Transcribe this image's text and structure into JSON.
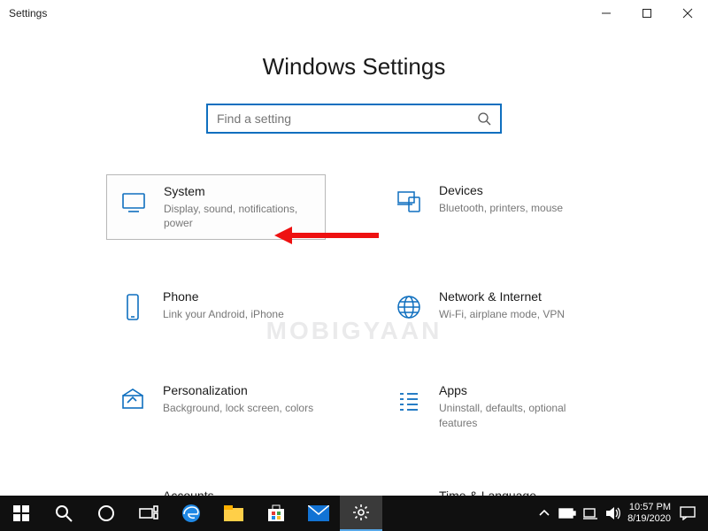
{
  "titlebar": {
    "app": "Settings"
  },
  "header": {
    "title": "Windows Settings"
  },
  "search": {
    "placeholder": "Find a setting",
    "value": ""
  },
  "watermark": "MOBIGYAAN",
  "tiles": [
    {
      "title": "System",
      "desc": "Display, sound, notifications, power"
    },
    {
      "title": "Devices",
      "desc": "Bluetooth, printers, mouse"
    },
    {
      "title": "Phone",
      "desc": "Link your Android, iPhone"
    },
    {
      "title": "Network & Internet",
      "desc": "Wi-Fi, airplane mode, VPN"
    },
    {
      "title": "Personalization",
      "desc": "Background, lock screen, colors"
    },
    {
      "title": "Apps",
      "desc": "Uninstall, defaults, optional features"
    },
    {
      "title": "Accounts",
      "desc": ""
    },
    {
      "title": "Time & Language",
      "desc": ""
    }
  ],
  "taskbar": {
    "time": "10:57 PM",
    "date": "8/19/2020"
  }
}
